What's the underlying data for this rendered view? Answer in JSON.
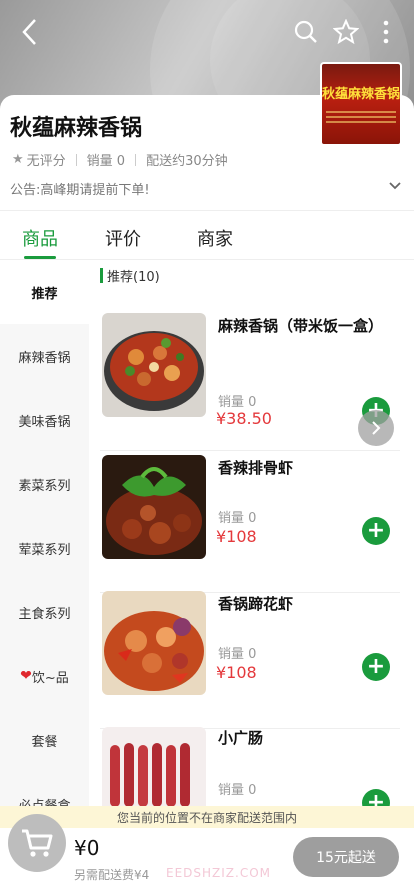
{
  "header": {
    "back_icon": "chevron-left-icon",
    "search_icon": "search-icon",
    "favorite_icon": "star-outline-icon",
    "more_icon": "more-vertical-icon"
  },
  "store": {
    "name": "秋蕴麻辣香锅",
    "thumbnail_text": "秋蕴麻辣香锅",
    "rating": "无评分",
    "sales": "销量 0",
    "delivery_time": "配送约30分钟",
    "notice": "公告:高峰期请提前下单!"
  },
  "tabs": [
    {
      "label": "商品",
      "active": true
    },
    {
      "label": "评价",
      "active": false
    },
    {
      "label": "商家",
      "active": false
    }
  ],
  "categories": [
    {
      "label": "推荐",
      "active": true
    },
    {
      "label": "麻辣香锅"
    },
    {
      "label": "美味香锅"
    },
    {
      "label": "素菜系列"
    },
    {
      "label": "荤菜系列"
    },
    {
      "label": "主食系列"
    },
    {
      "label": "饮~品",
      "icon": "heart-icon"
    },
    {
      "label": "套餐"
    },
    {
      "label": "必点餐盒"
    }
  ],
  "section": {
    "title": "推荐(10)"
  },
  "items": [
    {
      "name": "麻辣香锅（带米饭一盒）",
      "sales": "销量 0",
      "price": "¥38.50"
    },
    {
      "name": "香辣排骨虾",
      "sales": "销量 0",
      "price": "¥108"
    },
    {
      "name": "香锅蹄花虾",
      "sales": "销量 0",
      "price": "¥108"
    },
    {
      "name": "小广肠",
      "sales": "销量 0",
      "price": ""
    }
  ],
  "footer": {
    "warning": "您当前的位置不在商家配送范围内",
    "total": "¥0",
    "delivery_fee": "另需配送费¥4",
    "watermark": "EEDSHZIZ.COM",
    "checkout": "15元起送"
  },
  "colors": {
    "accent": "#1a9b3d",
    "price": "#e4393c"
  }
}
